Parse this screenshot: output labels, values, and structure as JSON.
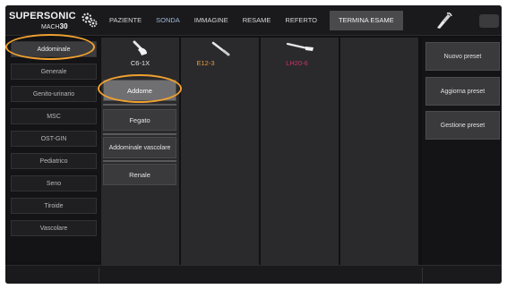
{
  "logo": {
    "brand": "SUPERSONIC",
    "model_prefix": "MACH",
    "model_number": "30",
    "icon": "gears-icon"
  },
  "menu": {
    "items": [
      "PAZIENTE",
      "SONDA",
      "IMMAGINE",
      "RESAME",
      "REFERTO"
    ],
    "active": "SONDA",
    "end_exam": "TERMINA ESAME"
  },
  "icons": {
    "probe_select": "probe-icon",
    "keyboard": "keyboard-icon"
  },
  "applications": {
    "selected": "Addominale",
    "items": [
      "Addominale",
      "Generale",
      "Genito-urinario",
      "MSC",
      "OST-GIN",
      "Pediatrico",
      "Seno",
      "Tiroide",
      "Vascolare"
    ]
  },
  "probes": [
    {
      "name": "C6-1X",
      "color": "#e6e6e6",
      "icon": "convex-probe-icon"
    },
    {
      "name": "E12-3",
      "color": "#e89a3c",
      "icon": "endocavity-probe-icon"
    },
    {
      "name": "LH20-6",
      "color": "#d0306a",
      "icon": "hockey-stick-probe-icon"
    }
  ],
  "presets": {
    "selected": "Addome",
    "items": [
      "Addome",
      "Fegato",
      "Addominale vascolare",
      "Renale"
    ]
  },
  "actions": {
    "new_preset": "Nuovo preset",
    "update_preset": "Aggiorna preset",
    "manage_preset": "Gestione preset"
  },
  "colors": {
    "highlight": "#f0a030",
    "active_menu": "#9fb9d8"
  }
}
